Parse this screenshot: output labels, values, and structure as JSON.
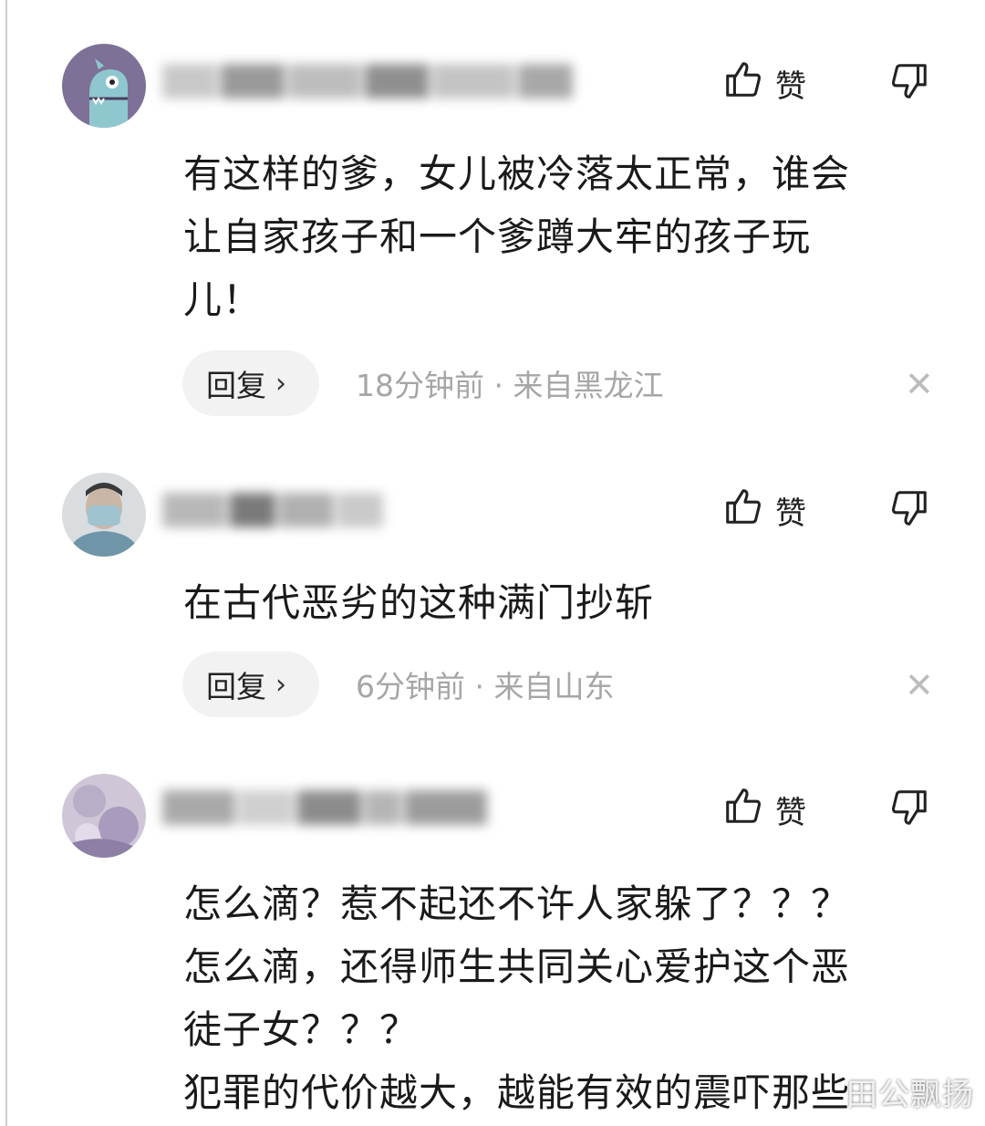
{
  "comments": [
    {
      "like_label": "赞",
      "content_lines": [
        "有这样的爹，女儿被冷落太正常，谁会",
        "让自家孩子和一个爹蹲大牢的孩子玩",
        "儿！"
      ],
      "reply_label": "回复",
      "meta": "18分钟前 · 来自黑龙江"
    },
    {
      "like_label": "赞",
      "content_lines": [
        "在古代恶劣的这种满门抄斩"
      ],
      "reply_label": "回复",
      "meta": "6分钟前 · 来自山东"
    },
    {
      "like_label": "赞",
      "content_lines": [
        "怎么滴？惹不起还不许人家躲了？？？",
        "怎么滴，还得师生共同关心爱护这个恶",
        "徒子女？？？",
        "犯罪的代价越大，越能有效的震吓那些"
      ]
    }
  ],
  "icons": {
    "like": "thumbs-up-icon",
    "dislike": "thumbs-down-icon",
    "reply_chevron": "chevron-right-icon",
    "close": "close-icon"
  },
  "watermark": "田公飘扬"
}
